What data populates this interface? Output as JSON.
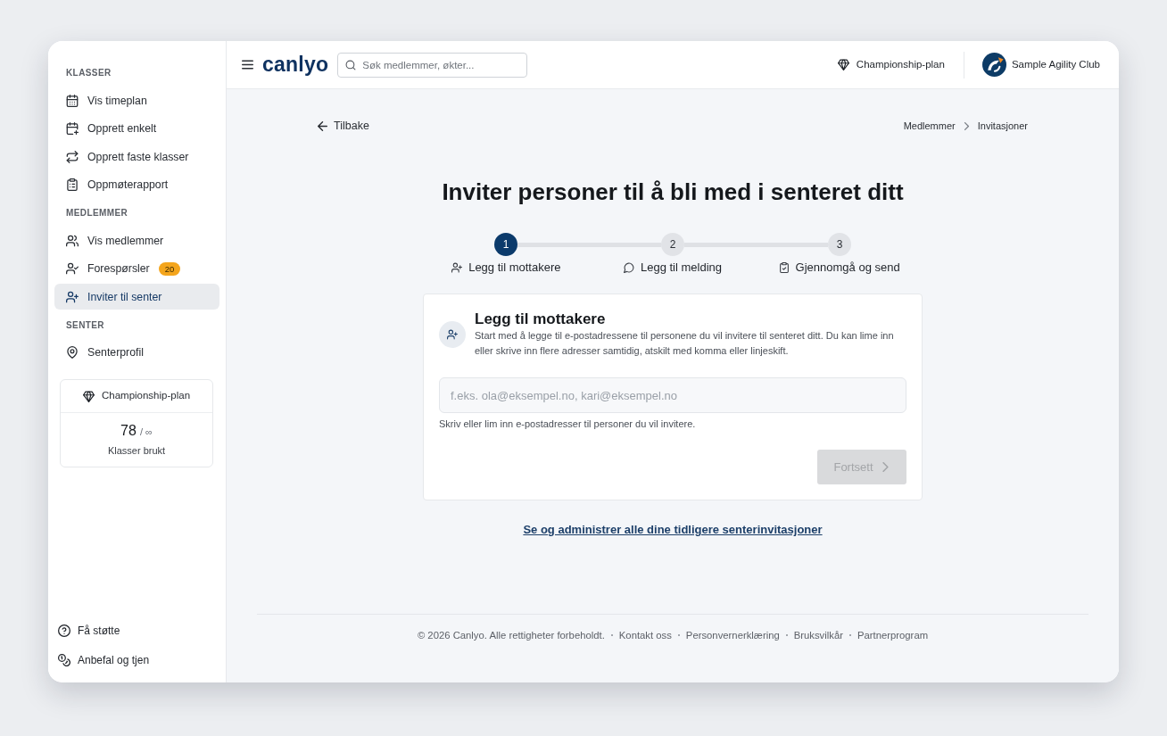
{
  "sidebar": {
    "sections": [
      {
        "heading": "KLASSER",
        "items": [
          {
            "label": "Vis timeplan",
            "selected": false
          },
          {
            "label": "Opprett enkelt",
            "selected": false
          },
          {
            "label": "Opprett faste klasser",
            "selected": false
          },
          {
            "label": "Oppmøterapport",
            "selected": false
          }
        ]
      },
      {
        "heading": "MEDLEMMER",
        "items": [
          {
            "label": "Vis medlemmer",
            "selected": false
          },
          {
            "label": "Forespørsler",
            "badge": "20",
            "selected": false
          },
          {
            "label": "Inviter til senter",
            "selected": true
          }
        ]
      },
      {
        "heading": "SENTER",
        "items": [
          {
            "label": "Senterprofil",
            "selected": false
          }
        ]
      }
    ],
    "plan_card": {
      "title": "Championship-plan",
      "used": "78",
      "limit": "/ ∞",
      "caption": "Klasser brukt"
    },
    "footer_links": [
      {
        "label": "Få støtte"
      },
      {
        "label": "Anbefal og tjen"
      }
    ]
  },
  "topbar": {
    "brand": "canlyo",
    "search": {
      "placeholder": "Søk medlemmer, økter..."
    },
    "plan": "Championship-plan",
    "club": "Sample Agility Club"
  },
  "page": {
    "back_link": "Tilbake",
    "breadcrumb": [
      {
        "label": "Medlemmer"
      },
      {
        "label": "Invitasjoner"
      }
    ],
    "title": "Inviter personer til å bli med i senteret ditt",
    "steps": [
      {
        "number": "1",
        "label": "Legg til mottakere",
        "selected": true
      },
      {
        "number": "2",
        "label": "Legg til melding",
        "selected": false
      },
      {
        "number": "3",
        "label": "Gjennomgå og send",
        "selected": false
      }
    ],
    "card": {
      "title": "Legg til mottakere",
      "description": "Start med å legge til e-postadressene til personene du vil invitere til senteret ditt. Du kan lime inn eller skrive inn flere adresser samtidig, atskilt med komma eller linjeskift.",
      "email_field": {
        "placeholder": "f.eks. ola@eksempel.no, kari@eksempel.no"
      },
      "help_text": "Skriv eller lim inn e-postadresser til personer du vil invitere.",
      "continue_button": {
        "label": "Fortsett",
        "disabled": true
      }
    },
    "history_link": "Se og administrer alle dine tidligere senterinvitasjoner"
  },
  "footer": {
    "copyright": "© 2026 Canlyo. Alle rettigheter forbeholdt.",
    "links": [
      "Kontakt oss",
      "Personvernerklæring",
      "Bruksvilkår",
      "Partnerprogram"
    ]
  }
}
